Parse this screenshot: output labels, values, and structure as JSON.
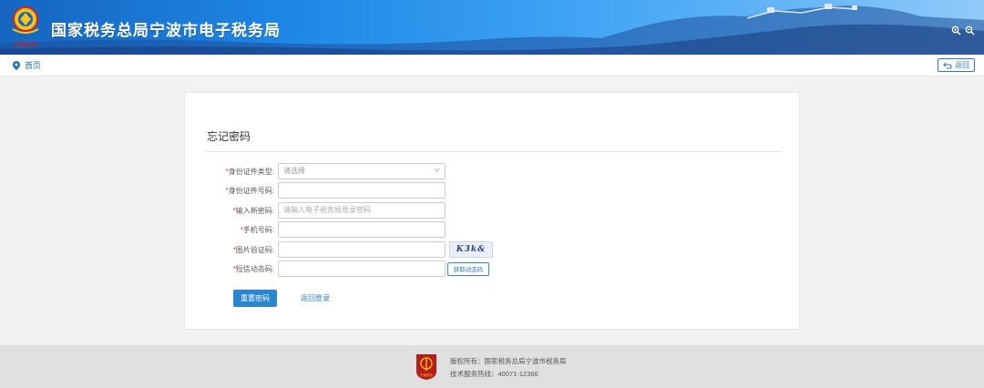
{
  "header": {
    "title": "国家税务总局宁波市电子税务局",
    "emblem_caption": "中国税务",
    "icons": [
      "zoom-in-icon",
      "zoom-out-icon"
    ],
    "colors": {
      "sky_top": "#1565c0",
      "sky_light": "#90caf9",
      "mountain": "#1e4e9a"
    }
  },
  "breadcrumb": {
    "home_label": "首页",
    "icon": "location-pin-icon"
  },
  "toolbar": {
    "back_label": "返回",
    "back_icon": "back-arrow-icon"
  },
  "form": {
    "title": "忘记密码",
    "required_mark": "*",
    "fields": [
      {
        "label": "身份证件类型",
        "type": "select",
        "value": "",
        "placeholder": "请选择"
      },
      {
        "label": "身份证件号码",
        "type": "text",
        "value": "",
        "placeholder": ""
      },
      {
        "label": "输入新密码",
        "type": "password",
        "value": "",
        "placeholder": "请输入电子税务局登录密码"
      },
      {
        "label": "手机号码",
        "type": "text",
        "value": "",
        "placeholder": ""
      },
      {
        "label": "图片验证码",
        "type": "text",
        "value": "",
        "placeholder": ""
      },
      {
        "label": "短信动态码",
        "type": "text",
        "value": "",
        "placeholder": ""
      }
    ],
    "captcha_text": "K3k&",
    "sms_button_label": "获取动态码",
    "submit_label": "重置密码",
    "return_login_label": "返回登录",
    "colors": {
      "primary": "#2a86d1",
      "required": "#e53935",
      "link": "#2a7ad0"
    }
  },
  "footer": {
    "copyright": "版权所有：国家税务总局宁波市税务局",
    "hotline": "技术服务热线：40071-12366",
    "logo_caption": "宁波税务"
  }
}
